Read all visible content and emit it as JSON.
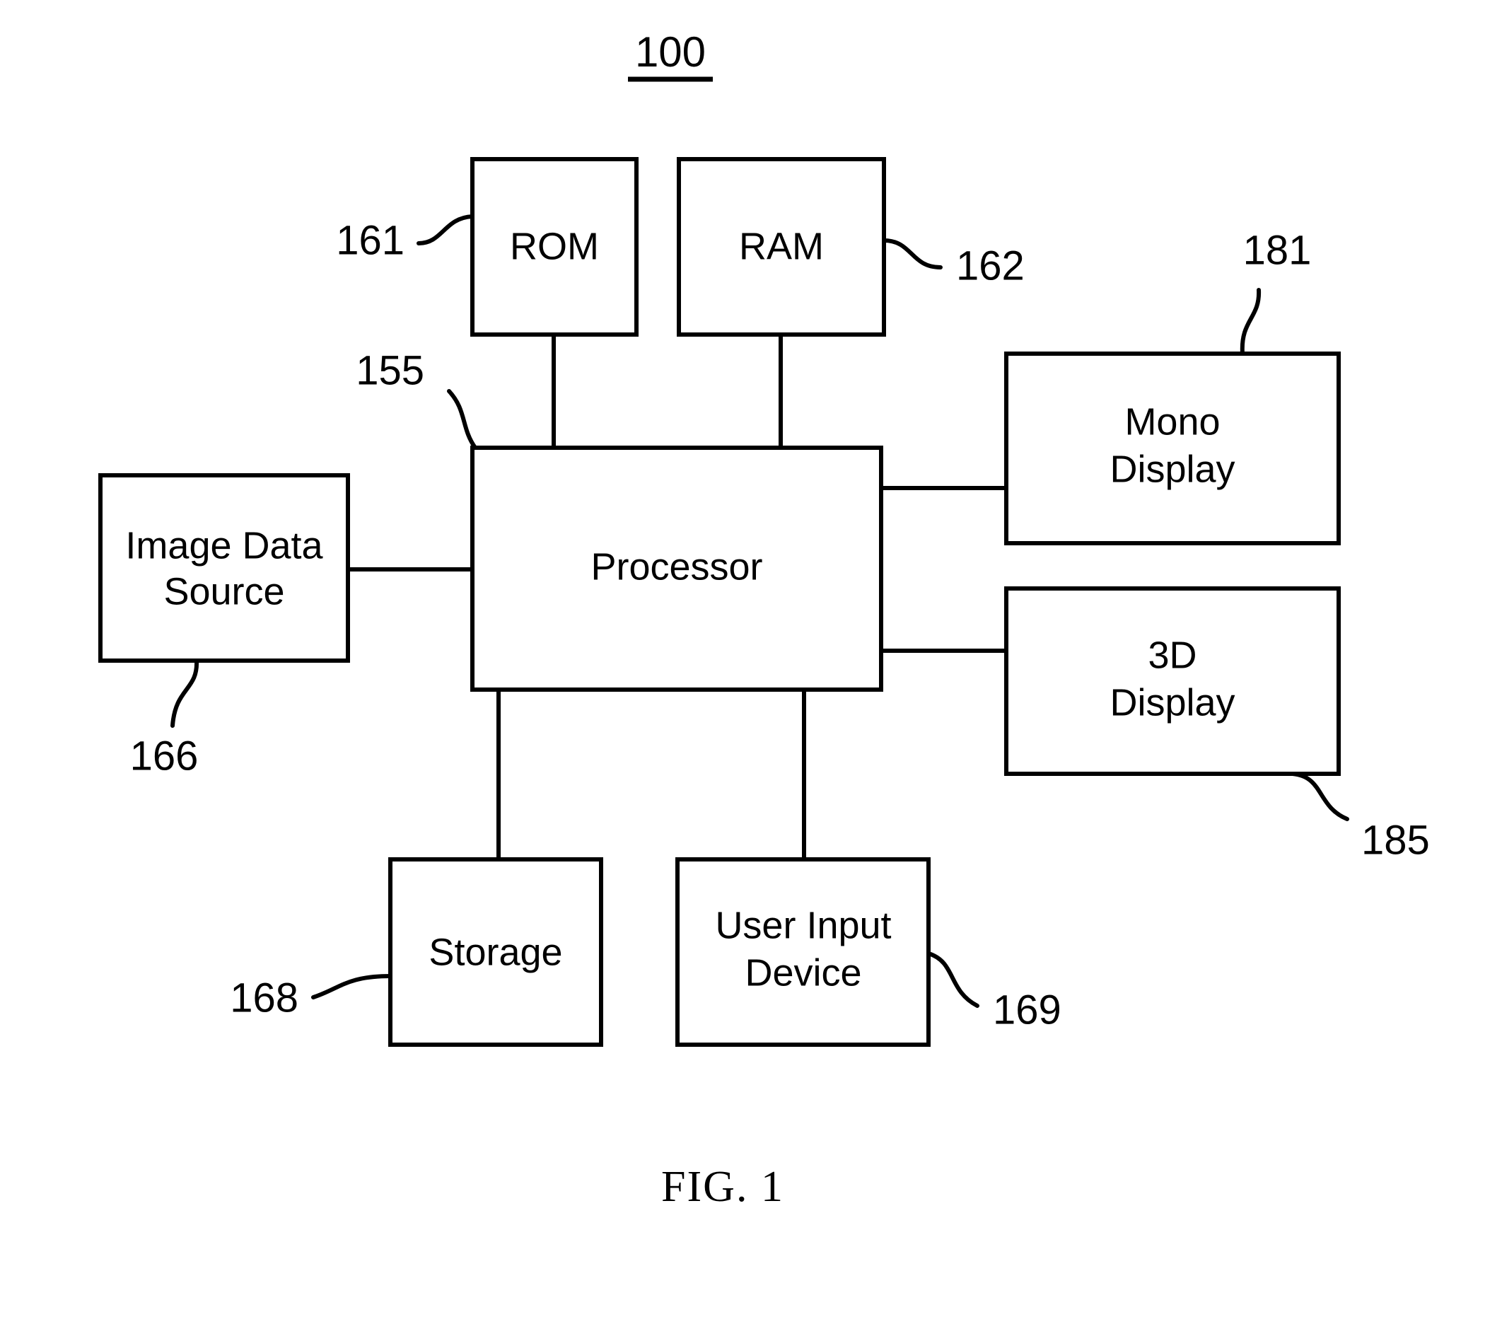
{
  "figure": {
    "system_number": "100",
    "caption": "FIG. 1",
    "background_color": "#ffffff",
    "line_color": "#000000"
  },
  "blocks": [
    {
      "id": "rom",
      "label": "ROM",
      "label_lines": [
        "ROM"
      ],
      "ref": "161"
    },
    {
      "id": "ram",
      "label": "RAM",
      "label_lines": [
        "RAM"
      ],
      "ref": "162"
    },
    {
      "id": "processor",
      "label": "Processor",
      "label_lines": [
        "Processor"
      ],
      "ref": "155"
    },
    {
      "id": "image_source",
      "label": "Image Data Source",
      "label_lines": [
        "Image Data",
        "Source"
      ],
      "ref": "166"
    },
    {
      "id": "mono_display",
      "label": "Mono Display",
      "label_lines": [
        "Mono",
        "Display"
      ],
      "ref": "181"
    },
    {
      "id": "td_display",
      "label": "3D Display",
      "label_lines": [
        "3D",
        "Display"
      ],
      "ref": "185"
    },
    {
      "id": "storage",
      "label": "Storage",
      "label_lines": [
        "Storage"
      ],
      "ref": "168"
    },
    {
      "id": "user_input",
      "label": "User Input Device",
      "label_lines": [
        "User Input",
        "Device"
      ],
      "ref": "169"
    }
  ],
  "connections": [
    {
      "from": "rom",
      "to": "processor"
    },
    {
      "from": "ram",
      "to": "processor"
    },
    {
      "from": "image_source",
      "to": "processor"
    },
    {
      "from": "processor",
      "to": "mono_display"
    },
    {
      "from": "processor",
      "to": "td_display"
    },
    {
      "from": "processor",
      "to": "storage"
    },
    {
      "from": "processor",
      "to": "user_input"
    }
  ],
  "text": {
    "rom_label": "ROM",
    "ram_label": "RAM",
    "processor_label": "Processor",
    "image_source_line1": "Image Data",
    "image_source_line2": "Source",
    "mono_display_line1": "Mono",
    "mono_display_line2": "Display",
    "td_display_line1": "3D",
    "td_display_line2": "Display",
    "storage_label": "Storage",
    "user_input_line1": "User Input",
    "user_input_line2": "Device",
    "ref_161": "161",
    "ref_162": "162",
    "ref_155": "155",
    "ref_166": "166",
    "ref_181": "181",
    "ref_185": "185",
    "ref_168": "168",
    "ref_169": "169",
    "system_number": "100",
    "caption": "FIG. 1"
  }
}
